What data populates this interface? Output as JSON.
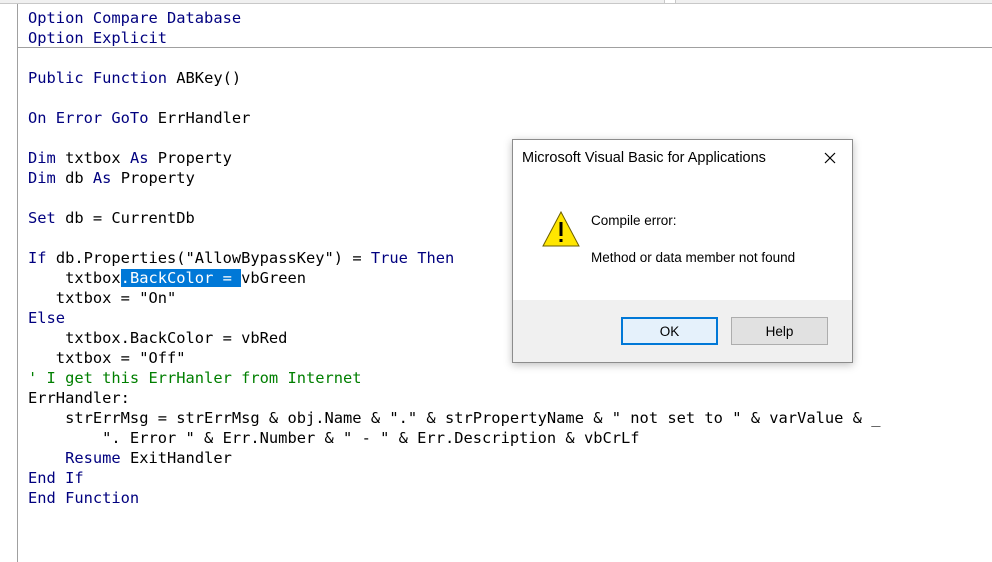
{
  "code": {
    "lines": [
      {
        "segments": [
          {
            "t": "Option Compare Database",
            "c": "kw"
          }
        ]
      },
      {
        "segments": [
          {
            "t": "Option Explicit",
            "c": "kw"
          }
        ]
      },
      {
        "segments": []
      },
      {
        "segments": [
          {
            "t": "Public Function",
            "c": "kw"
          },
          {
            "t": " ABKey()",
            "c": ""
          }
        ]
      },
      {
        "segments": []
      },
      {
        "segments": [
          {
            "t": "On Error GoTo",
            "c": "kw"
          },
          {
            "t": " ErrHandler",
            "c": ""
          }
        ]
      },
      {
        "segments": []
      },
      {
        "segments": [
          {
            "t": "Dim",
            "c": "kw"
          },
          {
            "t": " txtbox ",
            "c": ""
          },
          {
            "t": "As",
            "c": "kw"
          },
          {
            "t": " Property",
            "c": ""
          }
        ]
      },
      {
        "segments": [
          {
            "t": "Dim",
            "c": "kw"
          },
          {
            "t": " db ",
            "c": ""
          },
          {
            "t": "As",
            "c": "kw"
          },
          {
            "t": " Property",
            "c": ""
          }
        ]
      },
      {
        "segments": []
      },
      {
        "segments": [
          {
            "t": "Set",
            "c": "kw"
          },
          {
            "t": " db = CurrentDb",
            "c": ""
          }
        ]
      },
      {
        "segments": []
      },
      {
        "segments": [
          {
            "t": "If",
            "c": "kw"
          },
          {
            "t": " db.Properties(\"AllowBypassKey\") = ",
            "c": ""
          },
          {
            "t": "True",
            "c": "kw"
          },
          {
            "t": " ",
            "c": ""
          },
          {
            "t": "Then",
            "c": "kw"
          }
        ]
      },
      {
        "segments": [
          {
            "t": "    txtbox",
            "c": ""
          },
          {
            "t": ".BackColor = ",
            "c": "sel"
          },
          {
            "t": "vbGreen",
            "c": ""
          }
        ]
      },
      {
        "segments": [
          {
            "t": "   txtbox = \"On\"",
            "c": ""
          }
        ]
      },
      {
        "segments": [
          {
            "t": "Else",
            "c": "kw"
          }
        ]
      },
      {
        "segments": [
          {
            "t": "    txtbox.BackColor = vbRed",
            "c": ""
          }
        ]
      },
      {
        "segments": [
          {
            "t": "   txtbox = \"Off\"",
            "c": ""
          }
        ]
      },
      {
        "segments": [
          {
            "t": "' I get this ErrHanler from Internet",
            "c": "cm"
          }
        ]
      },
      {
        "segments": [
          {
            "t": "ErrHandler:",
            "c": ""
          }
        ]
      },
      {
        "segments": [
          {
            "t": "    strErrMsg = strErrMsg & obj.Name & \".\" & strPropertyName & \" not set to \" & varValue & _",
            "c": ""
          }
        ]
      },
      {
        "segments": [
          {
            "t": "        \". Error \" & Err.Number & \" - \" & Err.Description & vbCrLf",
            "c": ""
          }
        ]
      },
      {
        "segments": [
          {
            "t": "    ",
            "c": ""
          },
          {
            "t": "Resume",
            "c": "kw"
          },
          {
            "t": " ExitHandler",
            "c": ""
          }
        ]
      },
      {
        "segments": [
          {
            "t": "End If",
            "c": "kw"
          }
        ]
      },
      {
        "segments": [
          {
            "t": "End Function",
            "c": "kw"
          }
        ]
      }
    ]
  },
  "dialog": {
    "title": "Microsoft Visual Basic for Applications",
    "close_icon": "close-icon",
    "icon": "warning-icon",
    "message_line1": "Compile error:",
    "message_line2": "Method or data member not found",
    "ok_label": "OK",
    "help_label": "Help"
  },
  "colors": {
    "keyword": "#00007f",
    "comment": "#007f00",
    "selection": "#0078d7",
    "warning_fill": "#ffe600"
  }
}
